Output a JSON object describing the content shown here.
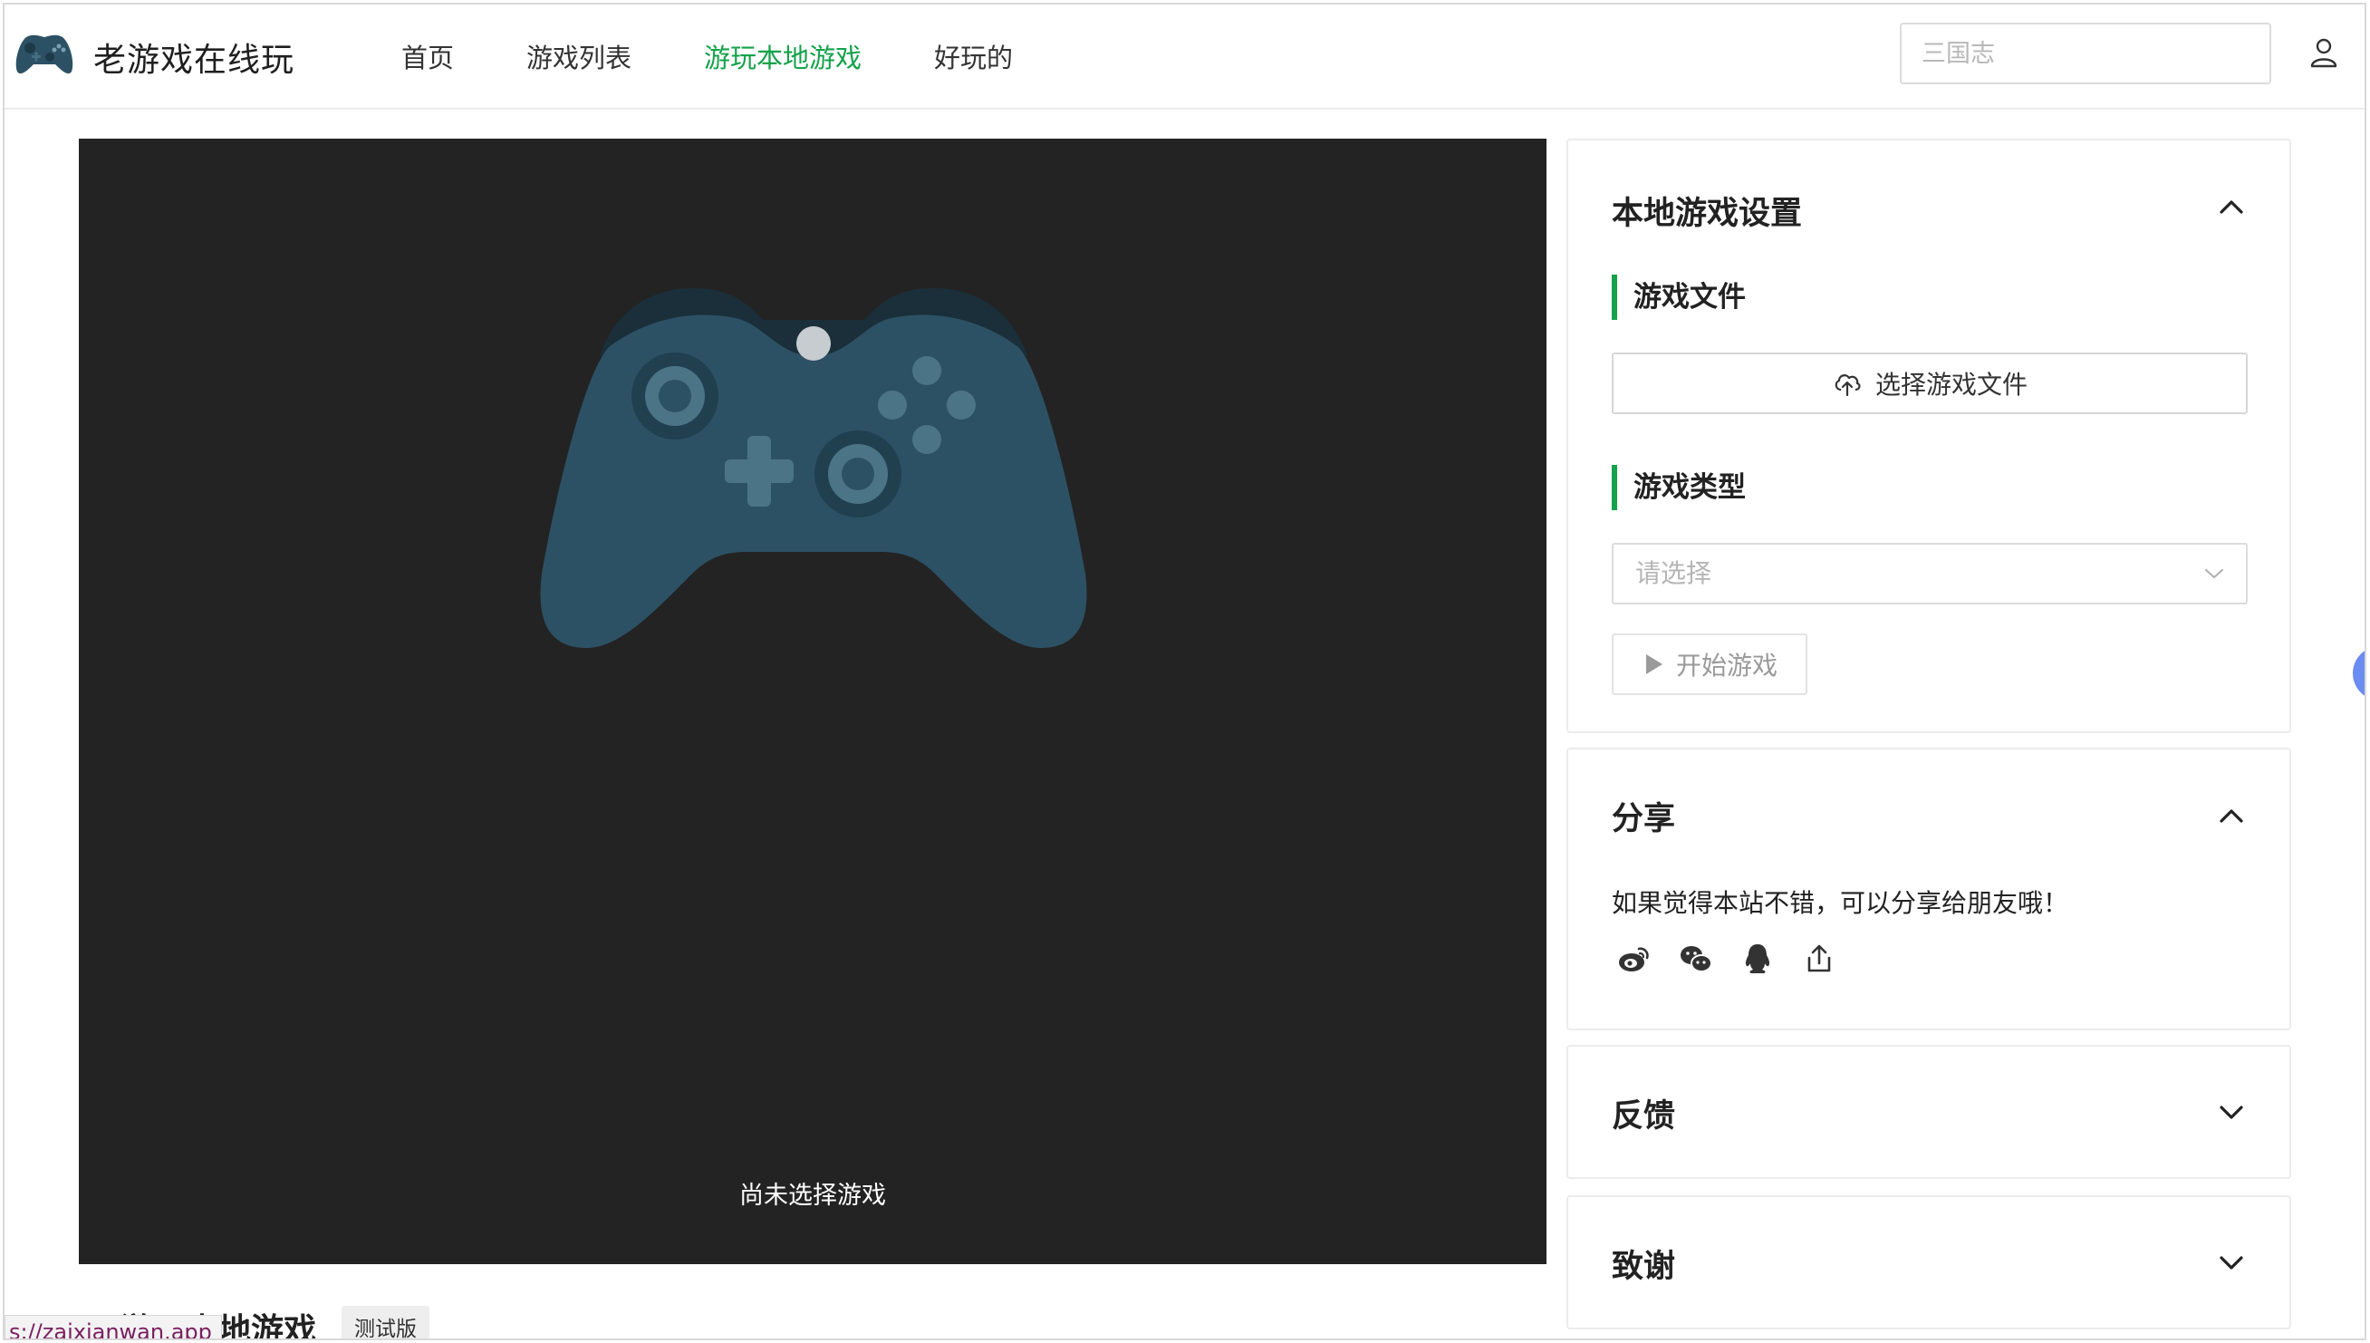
{
  "header": {
    "brand": "老游戏在线玩",
    "nav": [
      {
        "label": "首页"
      },
      {
        "label": "游戏列表"
      },
      {
        "label": "游玩本地游戏"
      },
      {
        "label": "好玩的"
      }
    ],
    "search_placeholder": "三国志"
  },
  "game_panel": {
    "status_text": "尚未选择游戏",
    "title_below": "游玩本地游戏",
    "badge": "测试版"
  },
  "status_bar": {
    "url": "s://zaixianwan.app"
  },
  "settings_card": {
    "title": "本地游戏设置",
    "file_section": "游戏文件",
    "file_button": "选择游戏文件",
    "type_section": "游戏类型",
    "type_placeholder": "请选择",
    "start_button": "开始游戏"
  },
  "share_card": {
    "title": "分享",
    "text": "如果觉得本站不错，可以分享给朋友哦！",
    "icons": [
      "weibo-icon",
      "wechat-icon",
      "qq-icon",
      "share-icon"
    ]
  },
  "feedback_card": {
    "title": "反馈"
  },
  "thanks_card": {
    "title": "致谢"
  },
  "colors": {
    "accent": "#14a24a",
    "panel_bg": "#232323",
    "controller": "#2d5164"
  }
}
